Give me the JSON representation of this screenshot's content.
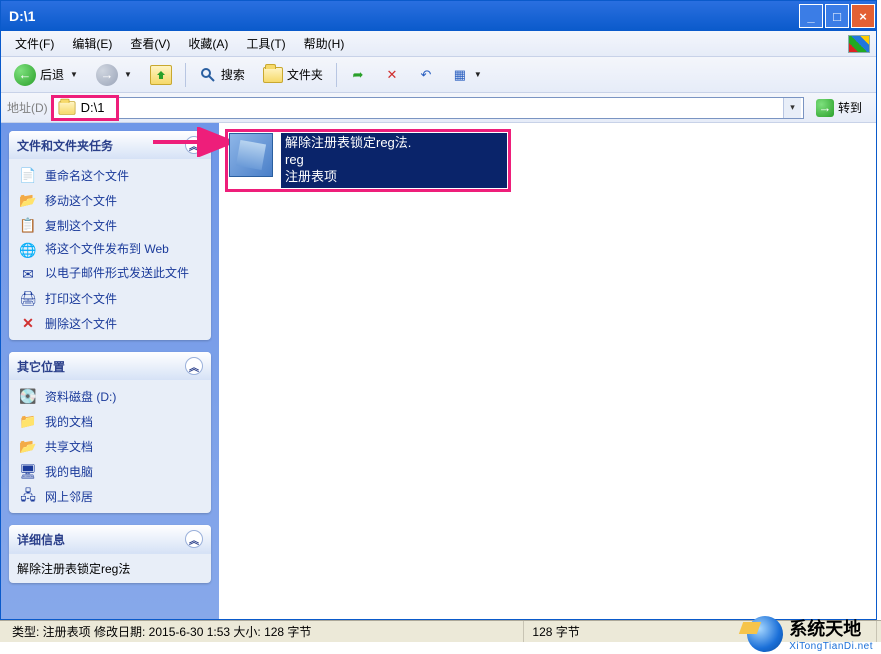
{
  "titlebar": {
    "title": "D:\\1"
  },
  "menubar": {
    "file": "文件(F)",
    "edit": "编辑(E)",
    "view": "查看(V)",
    "favorites": "收藏(A)",
    "tools": "工具(T)",
    "help": "帮助(H)"
  },
  "toolbar": {
    "back": "后退",
    "search": "搜索",
    "folders": "文件夹"
  },
  "addressbar": {
    "label": "地址(D)",
    "value": "D:\\1",
    "go": "转到"
  },
  "sidebar": {
    "tasks": {
      "header": "文件和文件夹任务",
      "items": [
        "重命名这个文件",
        "移动这个文件",
        "复制这个文件",
        "将这个文件发布到 Web",
        "以电子邮件形式发送此文件",
        "打印这个文件",
        "删除这个文件"
      ]
    },
    "other": {
      "header": "其它位置",
      "items": [
        "资料磁盘 (D:)",
        "我的文档",
        "共享文档",
        "我的电脑",
        "网上邻居"
      ]
    },
    "details": {
      "header": "详细信息",
      "truncated": "解除注册表锁定reg法"
    }
  },
  "content": {
    "file": {
      "name_line1": "解除注册表锁定reg法.",
      "name_line2": "reg",
      "type": "注册表项"
    }
  },
  "statusbar": {
    "main": "类型: 注册表项 修改日期: 2015-6-30 1:53 大小: 128 字节",
    "size": "128 字节"
  },
  "watermark": {
    "title": "系统天地",
    "url": "XiTongTianDi.net"
  }
}
